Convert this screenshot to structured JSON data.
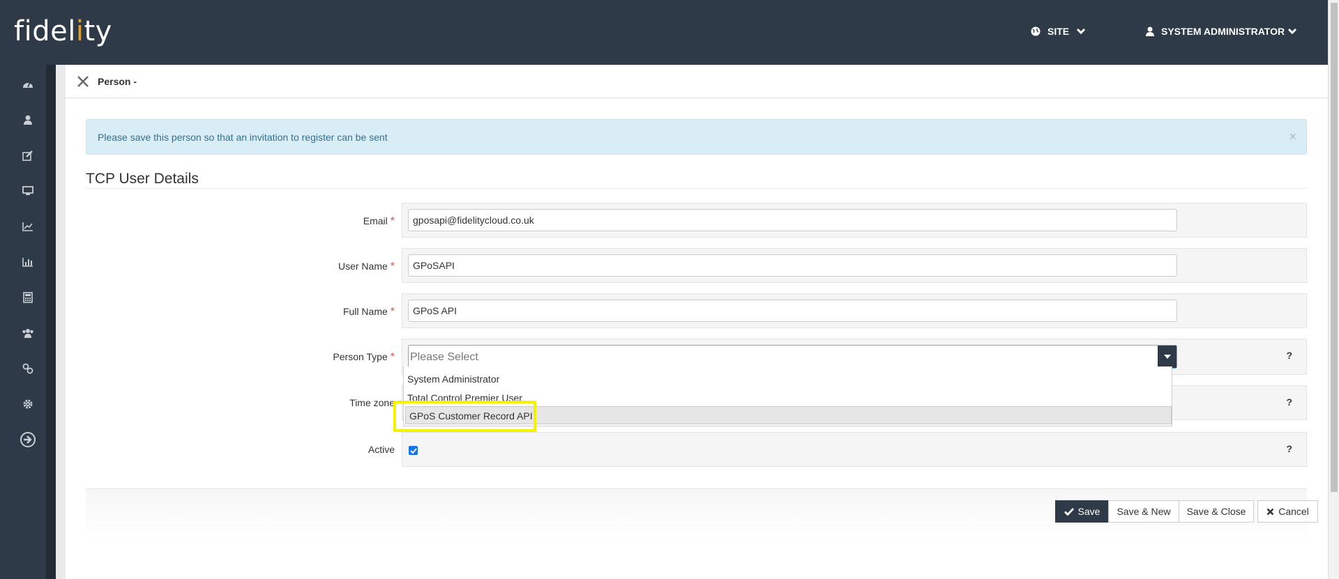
{
  "app": {
    "logo_text_before": "fidel",
    "logo_text_accent": "i",
    "logo_text_after": "ty"
  },
  "topbar": {
    "site_label": "SITE",
    "user_label": "SYSTEM ADMINISTRATOR"
  },
  "sidebar": {
    "items": [
      {
        "icon": "dashboard-icon"
      },
      {
        "icon": "user-icon"
      },
      {
        "icon": "edit-icon"
      },
      {
        "icon": "monitor-icon"
      },
      {
        "icon": "line-chart-icon"
      },
      {
        "icon": "bar-chart-icon"
      },
      {
        "icon": "calculator-icon"
      },
      {
        "icon": "users-icon"
      },
      {
        "icon": "link-icon"
      },
      {
        "icon": "gear-icon"
      },
      {
        "icon": "sign-out-icon"
      }
    ]
  },
  "tab": {
    "title": "Person -"
  },
  "alert": {
    "text": "Please save this person so that an invitation to register can be sent",
    "close": "×"
  },
  "form": {
    "section_title": "TCP User Details",
    "email_label": "Email",
    "email_value": "gposapi@fidelitycloud.co.uk",
    "username_label": "User Name",
    "username_value": "GPoSAPI",
    "fullname_label": "Full Name",
    "fullname_value": "GPoS API",
    "persontype_label": "Person Type",
    "persontype_placeholder": "Please Select",
    "timezone_label": "Time zone",
    "active_label": "Active",
    "active_checked": true,
    "required_mark": "*",
    "help_mark": "?"
  },
  "person_type_options": [
    "System Administrator",
    "Total Control Premier User",
    "GPoS Customer Record API"
  ],
  "highlighted_option": "GPoS Customer Record API",
  "footer": {
    "save_label": "Save",
    "save_new_label": "Save & New",
    "save_close_label": "Save & Close",
    "cancel_label": "Cancel"
  },
  "colors": {
    "navbar": "#2e3a48",
    "alert_bg": "#d9edf7",
    "alert_text": "#31708f",
    "highlight": "#f5f200",
    "required": "#d9534f"
  }
}
